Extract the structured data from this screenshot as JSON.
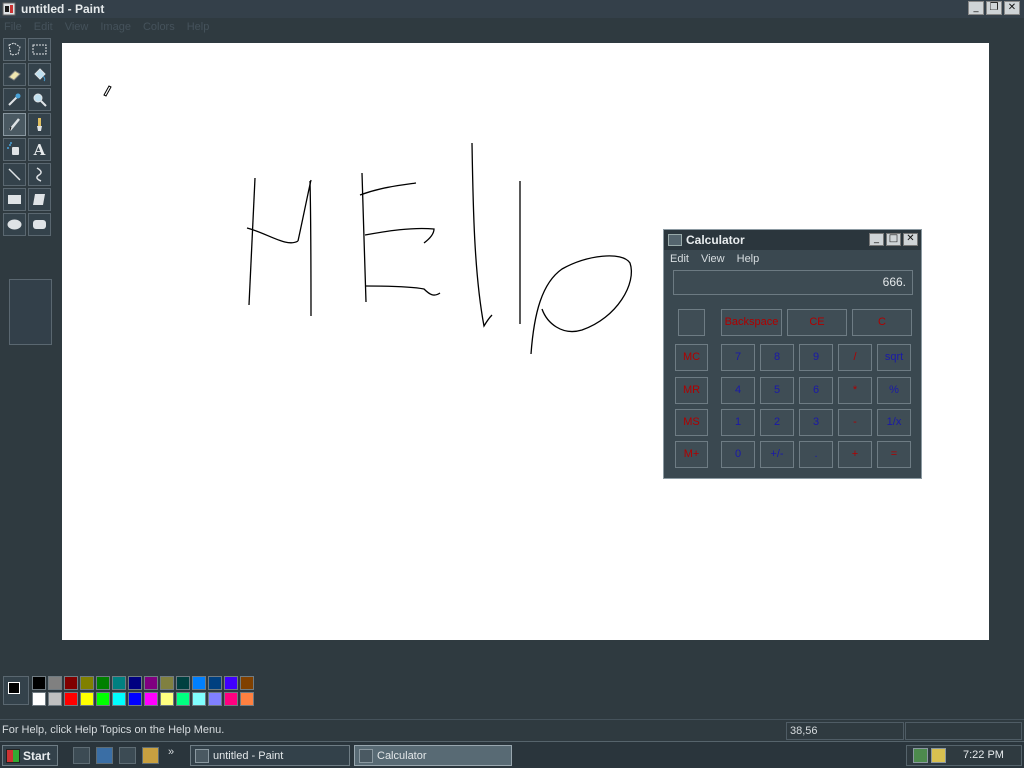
{
  "window": {
    "title": "untitled - Paint",
    "minimize_glyph": "_",
    "restore_glyph": "❐",
    "close_glyph": "✕"
  },
  "menu": [
    "File",
    "Edit",
    "View",
    "Image",
    "Colors",
    "Help"
  ],
  "tools": [
    {
      "name": "free-form-select-icon",
      "active": false
    },
    {
      "name": "rectangle-select-icon",
      "active": false
    },
    {
      "name": "eraser-icon",
      "active": false
    },
    {
      "name": "fill-bucket-icon",
      "active": false
    },
    {
      "name": "pick-color-icon",
      "active": false
    },
    {
      "name": "magnifier-icon",
      "active": false
    },
    {
      "name": "pencil-icon",
      "active": true
    },
    {
      "name": "brush-icon",
      "active": false
    },
    {
      "name": "airbrush-icon",
      "active": false
    },
    {
      "name": "text-icon",
      "active": false
    },
    {
      "name": "line-icon",
      "active": false
    },
    {
      "name": "curve-icon",
      "active": false
    },
    {
      "name": "rectangle-icon",
      "active": false
    },
    {
      "name": "polygon-icon",
      "active": false
    },
    {
      "name": "ellipse-icon",
      "active": false
    },
    {
      "name": "rounded-rectangle-icon",
      "active": false
    }
  ],
  "text_tool_glyph": "A",
  "canvas": {
    "drawing": "Hello"
  },
  "calculator": {
    "title": "Calculator",
    "menu": [
      "Edit",
      "View",
      "Help"
    ],
    "display": "666.",
    "minimize_glyph": "_",
    "maximize_glyph": "□",
    "close_glyph": "✕",
    "top_buttons": [
      "Backspace",
      "CE",
      "C"
    ],
    "rows": [
      [
        "MC",
        "7",
        "8",
        "9",
        "/",
        "sqrt"
      ],
      [
        "MR",
        "4",
        "5",
        "6",
        "*",
        "%"
      ],
      [
        "MS",
        "1",
        "2",
        "3",
        "-",
        "1/x"
      ],
      [
        "M+",
        "0",
        "+/-",
        ".",
        "+",
        "="
      ]
    ]
  },
  "palette": {
    "foreground": "#000000",
    "background": "#ffffff",
    "row1": [
      "#000000",
      "#808080",
      "#800000",
      "#808000",
      "#008000",
      "#008080",
      "#000080",
      "#800080",
      "#808040",
      "#004040",
      "#0080ff",
      "#004080",
      "#4000ff",
      "#804000"
    ],
    "row2": [
      "#ffffff",
      "#c0c0c0",
      "#ff0000",
      "#ffff00",
      "#00ff00",
      "#00ffff",
      "#0000ff",
      "#ff00ff",
      "#ffff80",
      "#00ff80",
      "#80ffff",
      "#8080ff",
      "#ff0080",
      "#ff8040"
    ]
  },
  "status": {
    "help": "For Help, click Help Topics on the Help Menu.",
    "coords": "38,56",
    "size": ""
  },
  "taskbar": {
    "start": "Start",
    "quicklaunch_more": "»",
    "tasks": [
      {
        "label": "untitled - Paint",
        "active": false
      },
      {
        "label": "Calculator",
        "active": true
      }
    ],
    "clock": "7:22 PM"
  }
}
